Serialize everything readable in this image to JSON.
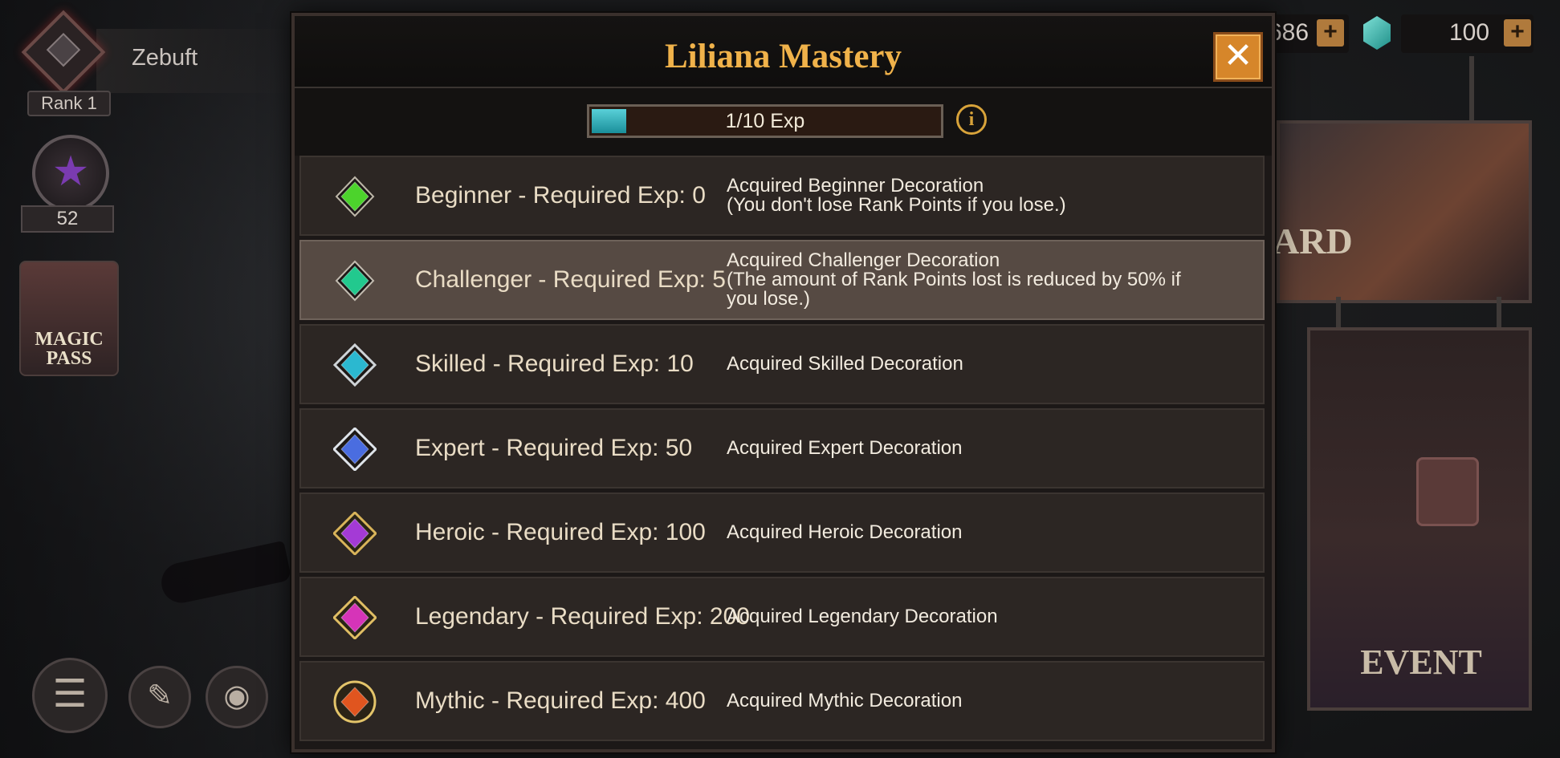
{
  "player": {
    "name": "Zebuft",
    "rank": "Rank 1",
    "level": "52"
  },
  "magic_pass": {
    "label": "MAGIC PASS"
  },
  "currency": {
    "gold": "686",
    "gems": "100"
  },
  "cards": {
    "board": "ARD",
    "event": "EVENT"
  },
  "modal": {
    "title": "Liliana Mastery",
    "close": "✕",
    "exp": {
      "label": "1/10 Exp",
      "progress": 0.1
    },
    "info": "i",
    "tiers": [
      {
        "name": "Beginner - Required Exp: 0",
        "reward": "Acquired Beginner Decoration",
        "reward_note": "(You don't lose Rank Points if you lose.)",
        "color": "#4cd32c"
      },
      {
        "name": "Challenger - Required Exp: 5",
        "reward": "Acquired Challenger Decoration",
        "reward_note": "(The amount of Rank Points lost is reduced by 50% if you lose.)",
        "color": "#22c98e"
      },
      {
        "name": "Skilled - Required Exp: 10",
        "reward": "Acquired Skilled Decoration",
        "reward_note": "",
        "color": "#2bb8d0"
      },
      {
        "name": "Expert - Required Exp: 50",
        "reward": "Acquired Expert Decoration",
        "reward_note": "",
        "color": "#4a6de0"
      },
      {
        "name": "Heroic - Required Exp: 100",
        "reward": "Acquired Heroic Decoration",
        "reward_note": "",
        "color": "#a43ad6"
      },
      {
        "name": "Legendary - Required Exp: 200",
        "reward": "Acquired Legendary Decoration",
        "reward_note": "",
        "color": "#d634b8"
      },
      {
        "name": "Mythic - Required Exp: 400",
        "reward": "Acquired Mythic Decoration",
        "reward_note": "",
        "color": "#e0551f"
      }
    ]
  }
}
